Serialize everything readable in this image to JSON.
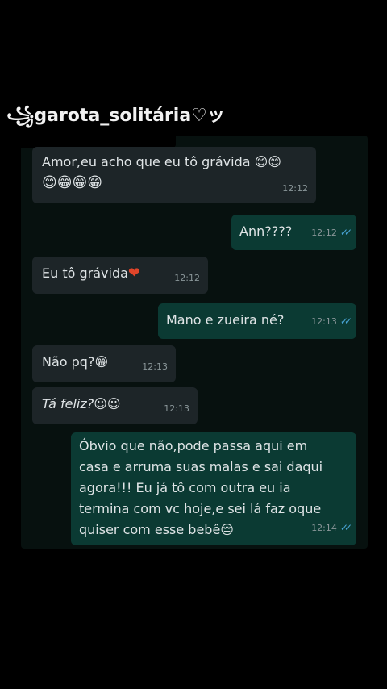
{
  "watermark": {
    "text": "꧁garota_solitária♡ッ"
  },
  "messages": [
    {
      "dir": "in",
      "text": "Amor,eu acho que eu tô grávida 😊😊",
      "text2": "😊😁😁😁",
      "time": "12:12"
    },
    {
      "dir": "out",
      "text": "Ann????",
      "time": "12:12",
      "ticks": "✓✓"
    },
    {
      "dir": "in",
      "text": "Eu tô grávida",
      "emoji": "❤",
      "time": "12:12"
    },
    {
      "dir": "out",
      "text": "Mano e zueira né?",
      "time": "12:13",
      "ticks": "✓✓"
    },
    {
      "dir": "in",
      "text": "Não pq?😁",
      "time": "12:13"
    },
    {
      "dir": "in",
      "text": "Tá feliz?☺☺",
      "time": "12:13"
    },
    {
      "dir": "out",
      "lines": [
        "Óbvio que não,pode passa aqui em",
        "casa e arruma suas malas e sai daqui",
        "agora!!! Eu já tô com outra eu ia",
        "termina com vc hoje,e sei lá faz oque",
        "quiser com esse bebê😔"
      ],
      "time": "12:14",
      "ticks": "✓✓"
    }
  ]
}
